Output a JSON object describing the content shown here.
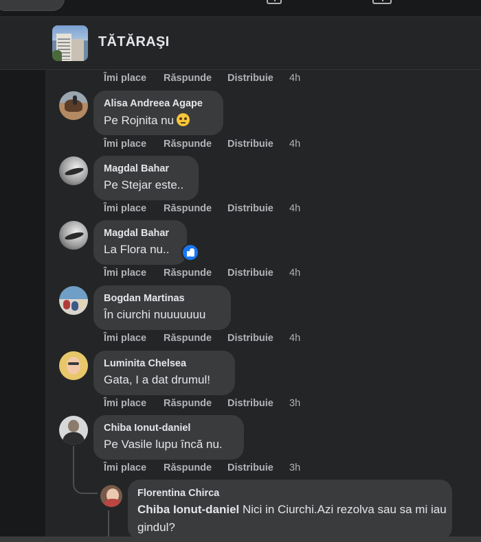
{
  "group": {
    "name": "TĂTĂRAŞI"
  },
  "labels": {
    "like": "Îmi place",
    "reply": "Răspunde",
    "share": "Distribuie"
  },
  "top_action_time": "4h",
  "comments": [
    {
      "author": "Alisa Andreea Agape",
      "text": "Pe Rojnita nu",
      "emoji": "eye-roll-emoji",
      "time": "4h"
    },
    {
      "author": "Magdal Bahar",
      "text": "Pe Stejar este..",
      "time": "4h"
    },
    {
      "author": "Magdal Bahar",
      "text": "La Flora nu..",
      "reaction": "like-reaction",
      "time": "4h"
    },
    {
      "author": "Bogdan Martinas",
      "text": "În ciurchi nuuuuuuu",
      "time": "4h"
    },
    {
      "author": "Luminita Chelsea",
      "text": "Gata, I a dat drumul!",
      "time": "3h"
    },
    {
      "author": "Chiba Ionut-daniel",
      "text": "Pe Vasile lupu încă nu.",
      "time": "3h"
    }
  ],
  "reply": {
    "author": "Florentina Chirca",
    "mention": "Chiba Ionut-daniel",
    "text": " Nici in Ciurchi.Azi rezolva sau sa mi iau gindul?"
  },
  "colors": {
    "background": "#18191a",
    "panel": "#242526",
    "bubble": "#3a3b3c",
    "text": "#e4e6eb",
    "muted": "#b0b3b8",
    "accent": "#1877f2"
  }
}
